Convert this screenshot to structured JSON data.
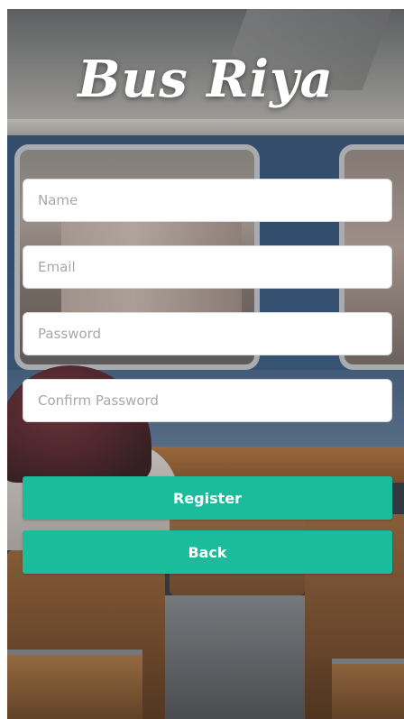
{
  "app": {
    "title": "Bus Riya"
  },
  "form": {
    "name_placeholder": "Name",
    "email_placeholder": "Email",
    "password_placeholder": "Password",
    "confirm_password_placeholder": "Confirm Password"
  },
  "actions": {
    "register_label": "Register",
    "back_label": "Back"
  },
  "colors": {
    "accent": "#1abc9c",
    "title_text": "#ffffff",
    "placeholder": "#a4a9ae"
  }
}
